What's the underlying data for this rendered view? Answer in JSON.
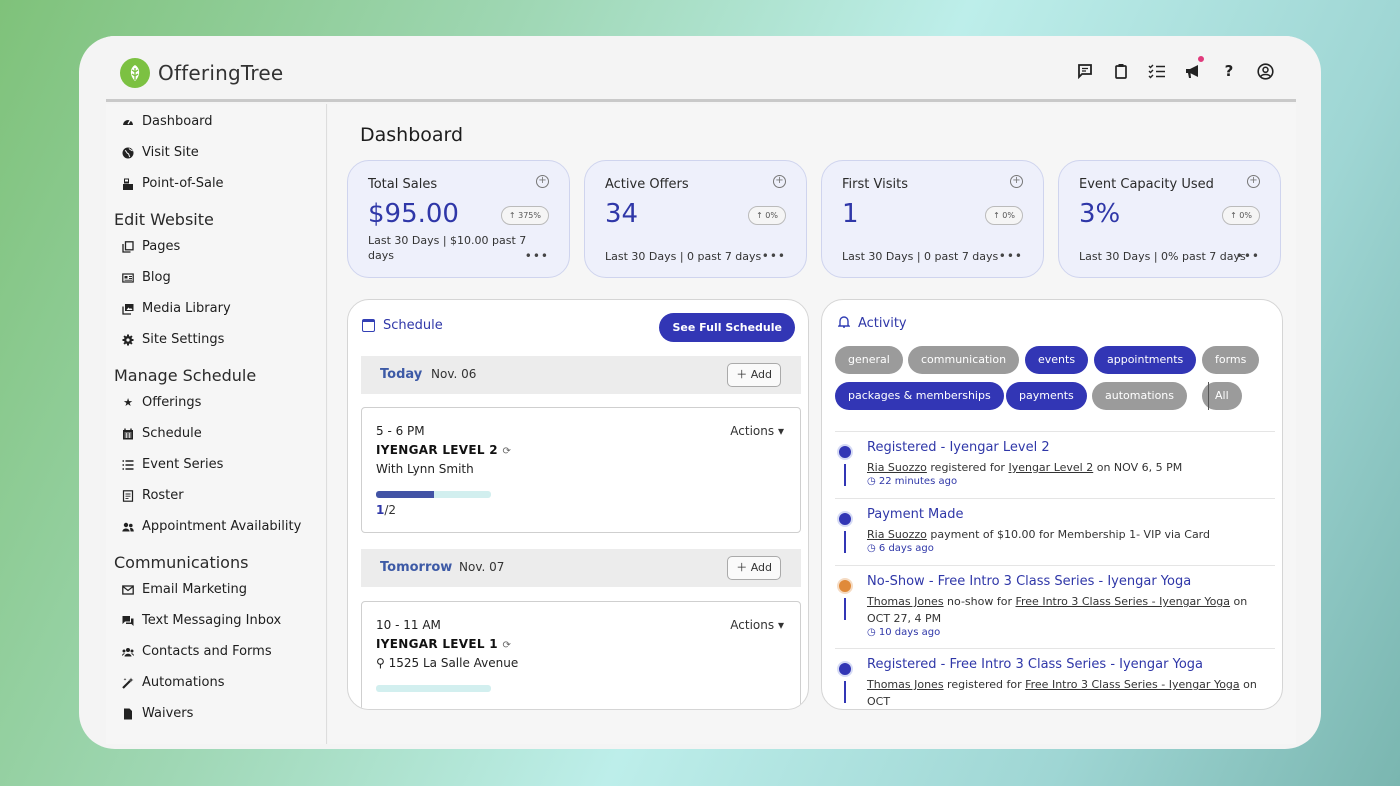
{
  "app": {
    "brand": "OfferingTree"
  },
  "header": {
    "icons": [
      "chat-icon",
      "clipboard-icon",
      "checklist-icon",
      "megaphone-icon",
      "help-icon",
      "account-icon"
    ],
    "help_glyph": "?"
  },
  "sidebar": {
    "top_items": [
      {
        "label": "Dashboard",
        "icon": "gauge-icon"
      },
      {
        "label": "Visit Site",
        "icon": "globe-icon"
      },
      {
        "label": "Point-of-Sale",
        "icon": "register-icon"
      }
    ],
    "edit_website": {
      "title": "Edit Website",
      "items": [
        {
          "label": "Pages",
          "icon": "pages-icon"
        },
        {
          "label": "Blog",
          "icon": "blog-icon"
        },
        {
          "label": "Media Library",
          "icon": "media-icon"
        },
        {
          "label": "Site Settings",
          "icon": "gear-icon"
        }
      ]
    },
    "manage_schedule": {
      "title": "Manage Schedule",
      "items": [
        {
          "label": "Offerings",
          "icon": "star-icon"
        },
        {
          "label": "Schedule",
          "icon": "calendar-icon"
        },
        {
          "label": "Event Series",
          "icon": "list-icon"
        },
        {
          "label": "Roster",
          "icon": "roster-icon"
        },
        {
          "label": "Appointment Availability",
          "icon": "people-icon"
        }
      ]
    },
    "communications": {
      "title": "Communications",
      "items": [
        {
          "label": "Email Marketing",
          "icon": "envelope-icon"
        },
        {
          "label": "Text Messaging Inbox",
          "icon": "message-icon"
        },
        {
          "label": "Contacts and Forms",
          "icon": "contacts-icon"
        },
        {
          "label": "Automations",
          "icon": "wand-icon"
        },
        {
          "label": "Waivers",
          "icon": "document-icon"
        }
      ]
    }
  },
  "main": {
    "title": "Dashboard",
    "stats": [
      {
        "label": "Total Sales",
        "value": "$95.00",
        "change": "↑ 375%",
        "sub": "Last 30 Days | $10.00 past 7 days"
      },
      {
        "label": "Active Offers",
        "value": "34",
        "change": "↑ 0%",
        "sub": "Last 30 Days | 0 past 7 days"
      },
      {
        "label": "First Visits",
        "value": "1",
        "change": "↑ 0%",
        "sub": "Last 30 Days | 0 past 7 days"
      },
      {
        "label": "Event Capacity Used",
        "value": "3%",
        "change": "↑ 0%",
        "sub": "Last 30 Days | 0% past 7 days"
      }
    ],
    "more_glyph": "•••",
    "schedule": {
      "title": "Schedule",
      "full_button": "See Full Schedule",
      "add_label": "Add",
      "days": [
        {
          "name": "Today",
          "date": "Nov. 06",
          "class": {
            "time": "5 - 6 PM",
            "actions": "Actions",
            "name": "IYENGAR LEVEL 2",
            "sub": "With Lynn Smith",
            "booked": "1",
            "capacity": "/2",
            "fill": 0.5
          }
        },
        {
          "name": "Tomorrow",
          "date": "Nov. 07",
          "class": {
            "time": "10 - 11 AM",
            "actions": "Actions",
            "name": "IYENGAR LEVEL 1",
            "sub": "1525 La Salle Avenue",
            "fill": 0
          }
        }
      ]
    },
    "activity": {
      "title": "Activity",
      "tags": [
        {
          "label": "general",
          "active": false
        },
        {
          "label": "communication",
          "active": false
        },
        {
          "label": "events",
          "active": true
        },
        {
          "label": "appointments",
          "active": true
        },
        {
          "label": "forms",
          "active": false
        },
        {
          "label": "packages & memberships",
          "active": true
        },
        {
          "label": "payments",
          "active": true
        },
        {
          "label": "automations",
          "active": false
        },
        {
          "label": "All",
          "active": false
        }
      ],
      "feed": [
        {
          "title": "Registered - Iyengar Level 2",
          "who": "Ria Suozzo",
          "mid": " registered for ",
          "target": "Iyengar Level 2",
          "tail": " on NOV 6, 5 PM",
          "time": "22 minutes ago",
          "icon": "calendar-icon",
          "color": "blue"
        },
        {
          "title": "Payment Made",
          "who": "Ria Suozzo",
          "mid": " payment of $10.00 for Membership 1- VIP via Card",
          "target": "",
          "tail": "",
          "time": "6 days ago",
          "icon": "cart-icon",
          "color": "blue"
        },
        {
          "title": "No-Show - Free Intro 3 Class Series - Iyengar Yoga",
          "who": "Thomas Jones",
          "mid": " no-show for ",
          "target": "Free Intro 3 Class Series - Iyengar Yoga",
          "tail": " on OCT 27, 4 PM",
          "time": "10 days ago",
          "icon": "calendar-icon",
          "color": "orange"
        },
        {
          "title": "Registered - Free Intro 3 Class Series - Iyengar Yoga",
          "who": "Thomas Jones",
          "mid": " registered for ",
          "target": "Free Intro 3 Class Series - Iyengar Yoga",
          "tail": " on OCT",
          "time": "",
          "icon": "calendar-icon",
          "color": "blue"
        }
      ]
    }
  }
}
